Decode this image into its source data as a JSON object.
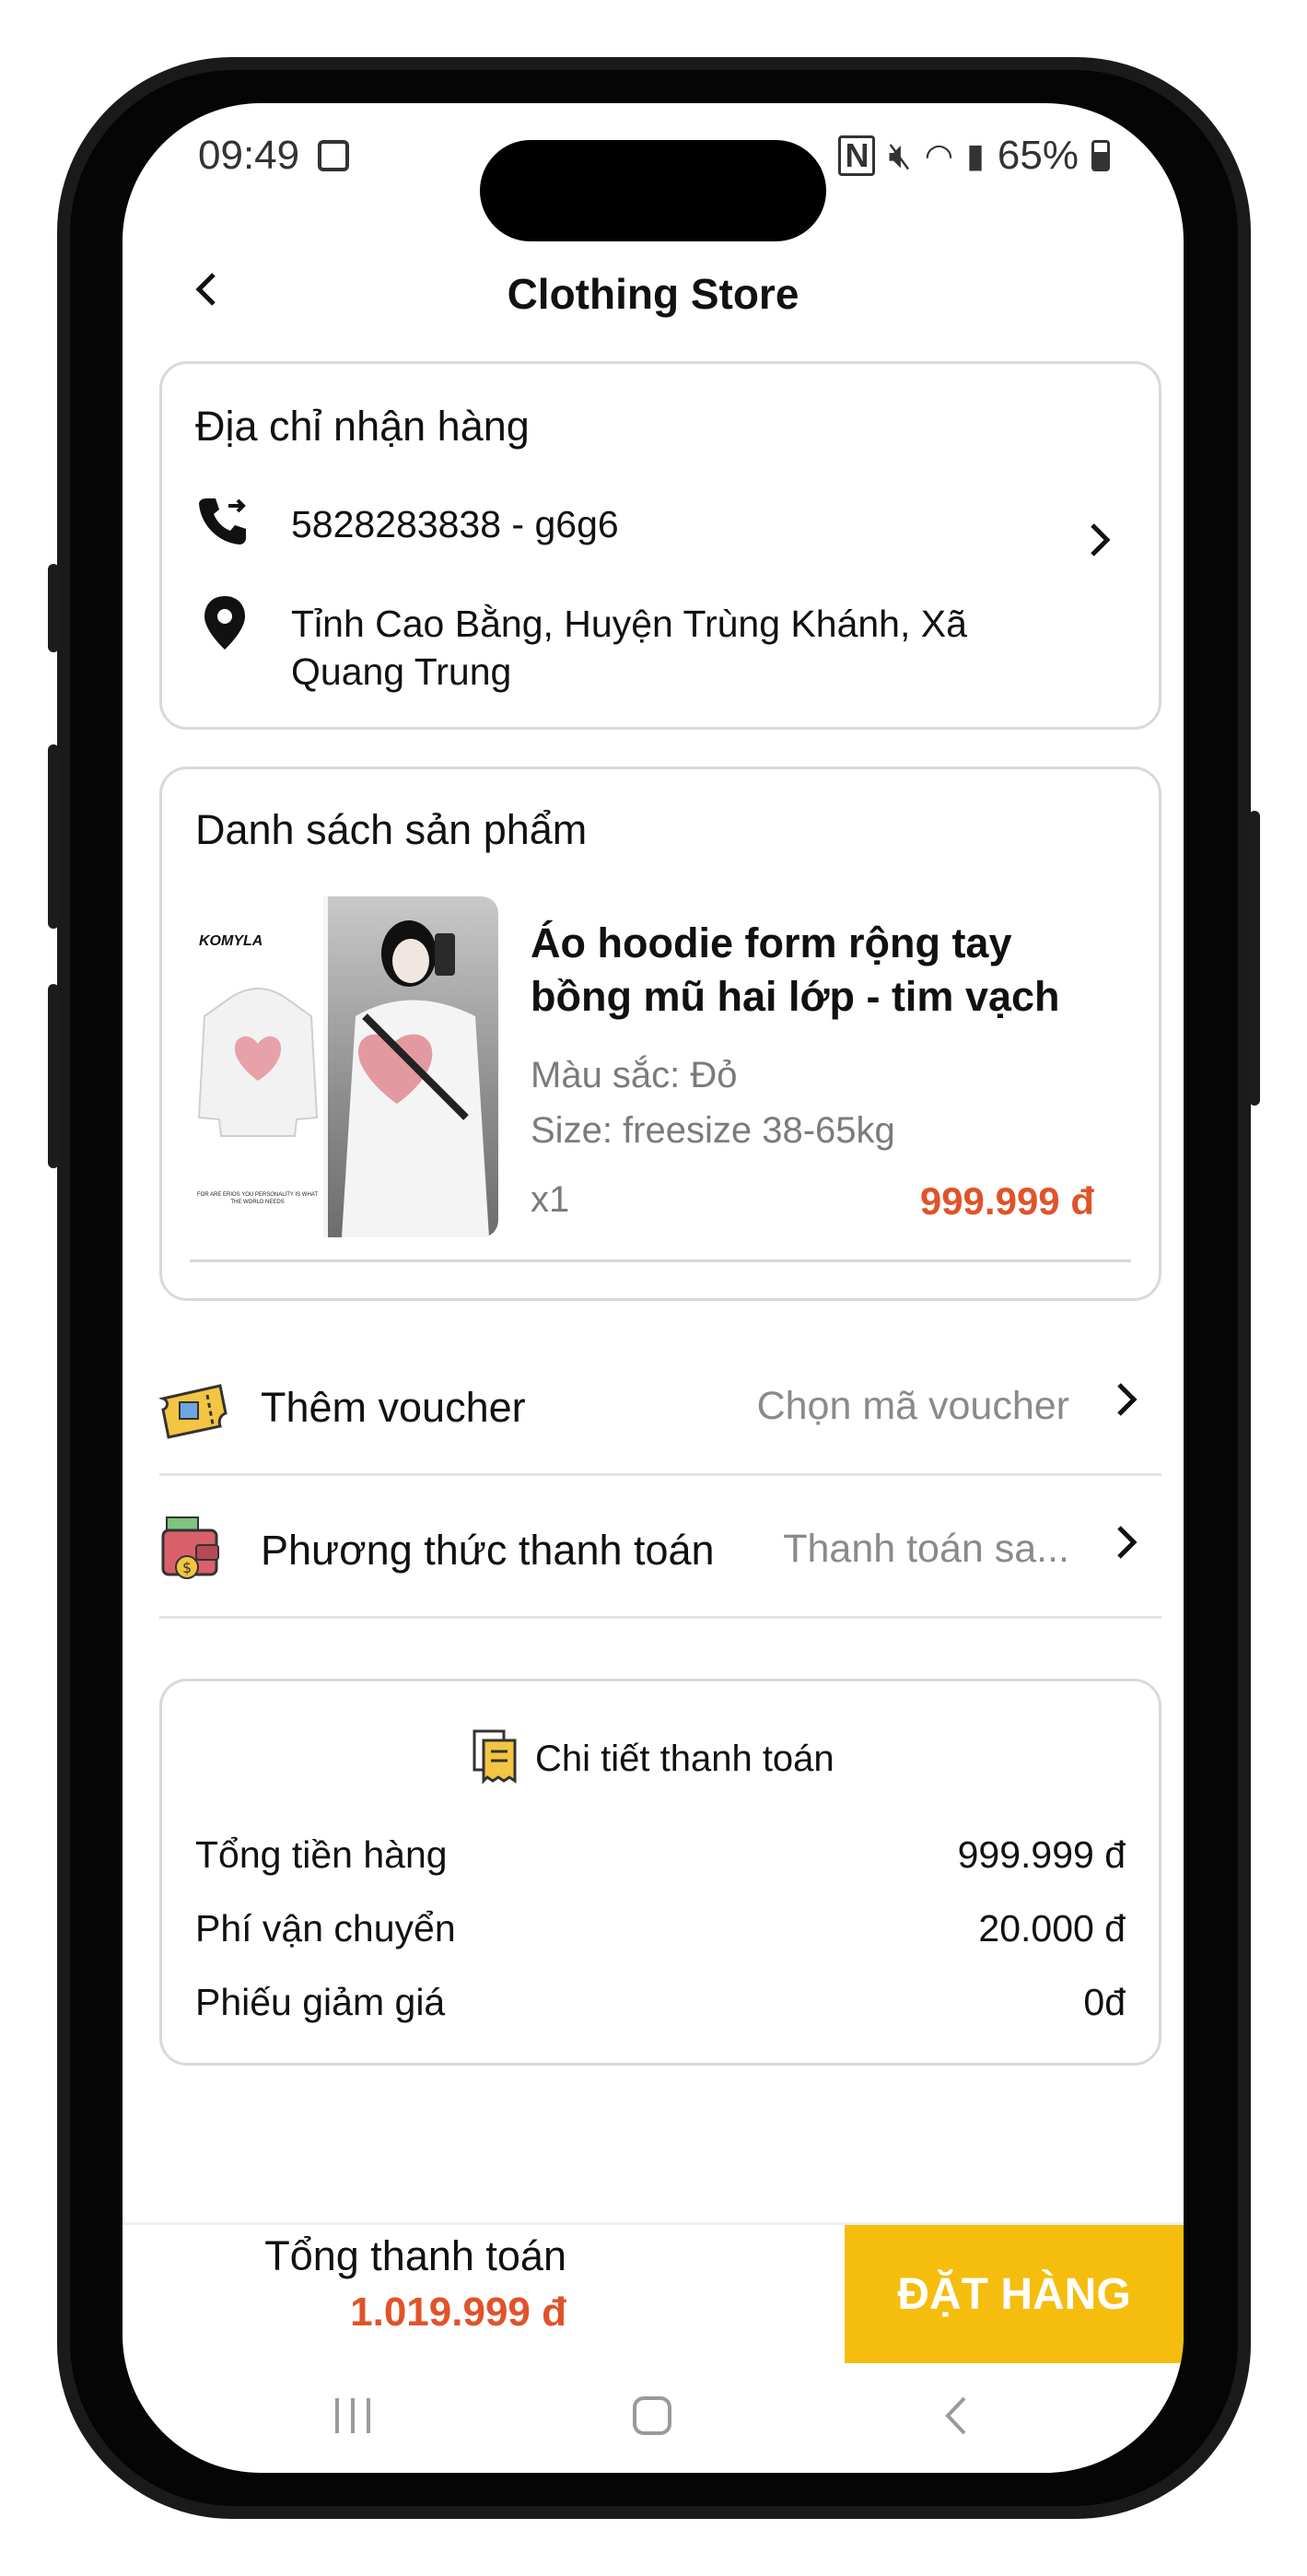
{
  "status_bar": {
    "time": "09:49",
    "battery": "65%"
  },
  "header": {
    "title": "Clothing Store"
  },
  "address": {
    "section_title": "Địa chỉ nhận hàng",
    "phone_line": "5828283838 - g6g6",
    "address_line": "Tỉnh Cao Bằng, Huyện Trùng Khánh, Xã Quang Trung"
  },
  "products": {
    "section_title": "Danh sách sản phẩm",
    "items": [
      {
        "image_brand": "KOMYLA",
        "image_caption": "FOR ARE ERIOS YOU PERSONALITY IS WHAT THE WORLD NEEDS",
        "name": "Áo hoodie form rộng tay bồng mũ hai lớp - tim vạch",
        "color": "Màu sắc: Đỏ",
        "size": "Size: freesize 38-65kg",
        "quantity": "x1",
        "price": "999.999 đ"
      }
    ]
  },
  "voucher": {
    "label": "Thêm voucher",
    "value": "Chọn mã voucher"
  },
  "payment_method": {
    "label": "Phương thức thanh toán",
    "value": "Thanh toán sa..."
  },
  "payment_details": {
    "title": "Chi tiết thanh toán",
    "rows": [
      {
        "label": "Tổng tiền hàng",
        "value": "999.999 đ"
      },
      {
        "label": "Phí vận chuyển",
        "value": "20.000 đ"
      },
      {
        "label": "Phiếu giảm giá",
        "value": "0đ"
      }
    ]
  },
  "footer": {
    "total_label": "Tổng thanh toán",
    "total_value": "1.019.999 đ",
    "order_button": "ĐẶT HÀNG"
  },
  "colors": {
    "accent": "#f5bd0e",
    "price": "#e0532a"
  }
}
